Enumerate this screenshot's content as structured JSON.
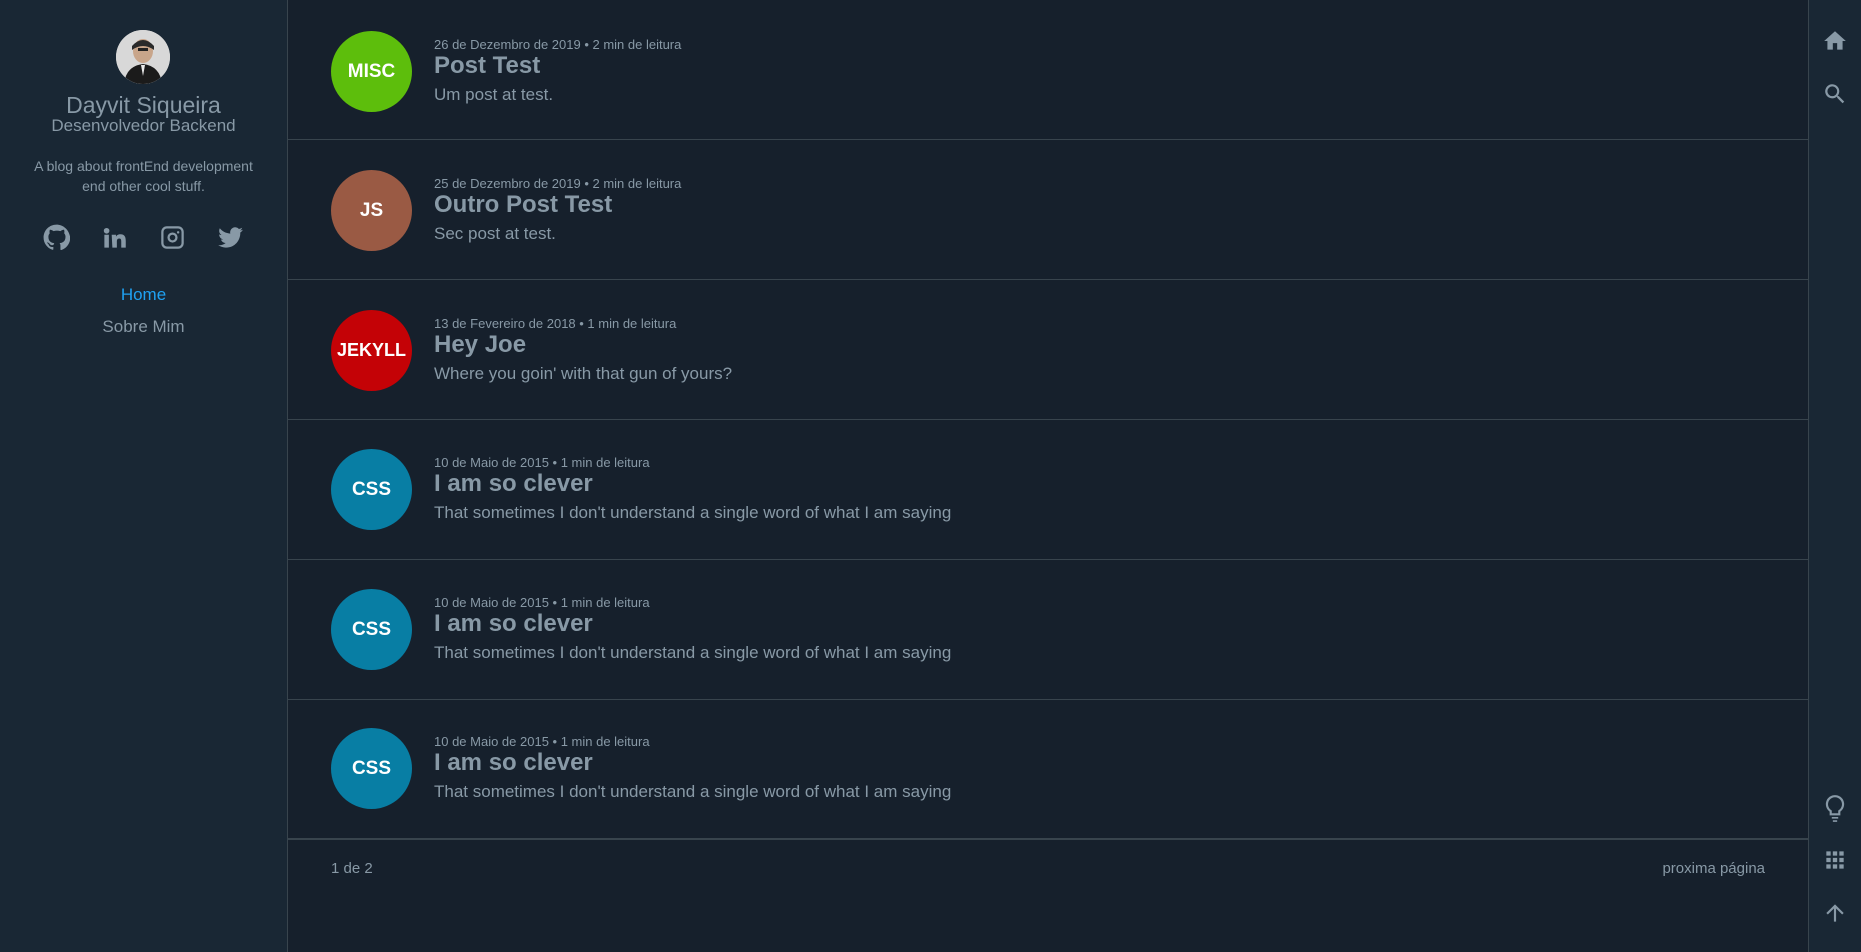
{
  "sidebar": {
    "author_name": "Dayvit Siqueira",
    "author_role": "Desenvolvedor Backend",
    "description": "A blog about frontEnd development end other cool stuff.",
    "social": [
      {
        "name": "github-icon"
      },
      {
        "name": "linkedin-icon"
      },
      {
        "name": "instagram-icon"
      },
      {
        "name": "twitter-icon"
      }
    ],
    "menu": [
      {
        "label": "Home",
        "active": true
      },
      {
        "label": "Sobre Mim",
        "active": false
      }
    ]
  },
  "posts": [
    {
      "tag": "MISC",
      "color": "#5dbe0c",
      "meta": "26 de Dezembro de 2019 • 2 min de leitura",
      "title": "Post Test",
      "description": "Um post at test."
    },
    {
      "tag": "JS",
      "color": "#9a5a44",
      "meta": "25 de Dezembro de 2019 • 2 min de leitura",
      "title": "Outro Post Test",
      "description": "Sec post at test."
    },
    {
      "tag": "JEKYLL",
      "color": "#c40206",
      "meta": "13 de Fevereiro de 2018 • 1 min de leitura",
      "title": "Hey Joe",
      "description": "Where you goin' with that gun of yours?"
    },
    {
      "tag": "CSS",
      "color": "#087ea4",
      "meta": "10 de Maio de 2015 • 1 min de leitura",
      "title": "I am so clever",
      "description": "That sometimes I don't understand a single word of what I am saying"
    },
    {
      "tag": "CSS",
      "color": "#087ea4",
      "meta": "10 de Maio de 2015 • 1 min de leitura",
      "title": "I am so clever",
      "description": "That sometimes I don't understand a single word of what I am saying"
    },
    {
      "tag": "CSS",
      "color": "#087ea4",
      "meta": "10 de Maio de 2015 • 1 min de leitura",
      "title": "I am so clever",
      "description": "That sometimes I don't understand a single word of what I am saying"
    }
  ],
  "pagination": {
    "page_info": "1 de 2",
    "next_label": "proxima página"
  },
  "rail": {
    "icons": [
      "home-icon",
      "search-icon",
      "lightbulb-icon",
      "grid-icon",
      "arrow-up-icon"
    ]
  },
  "colors": {
    "background": "#16202c",
    "panel": "#192734",
    "border": "#38444d",
    "text": "#8899a6",
    "accent": "#1fa1f2"
  }
}
